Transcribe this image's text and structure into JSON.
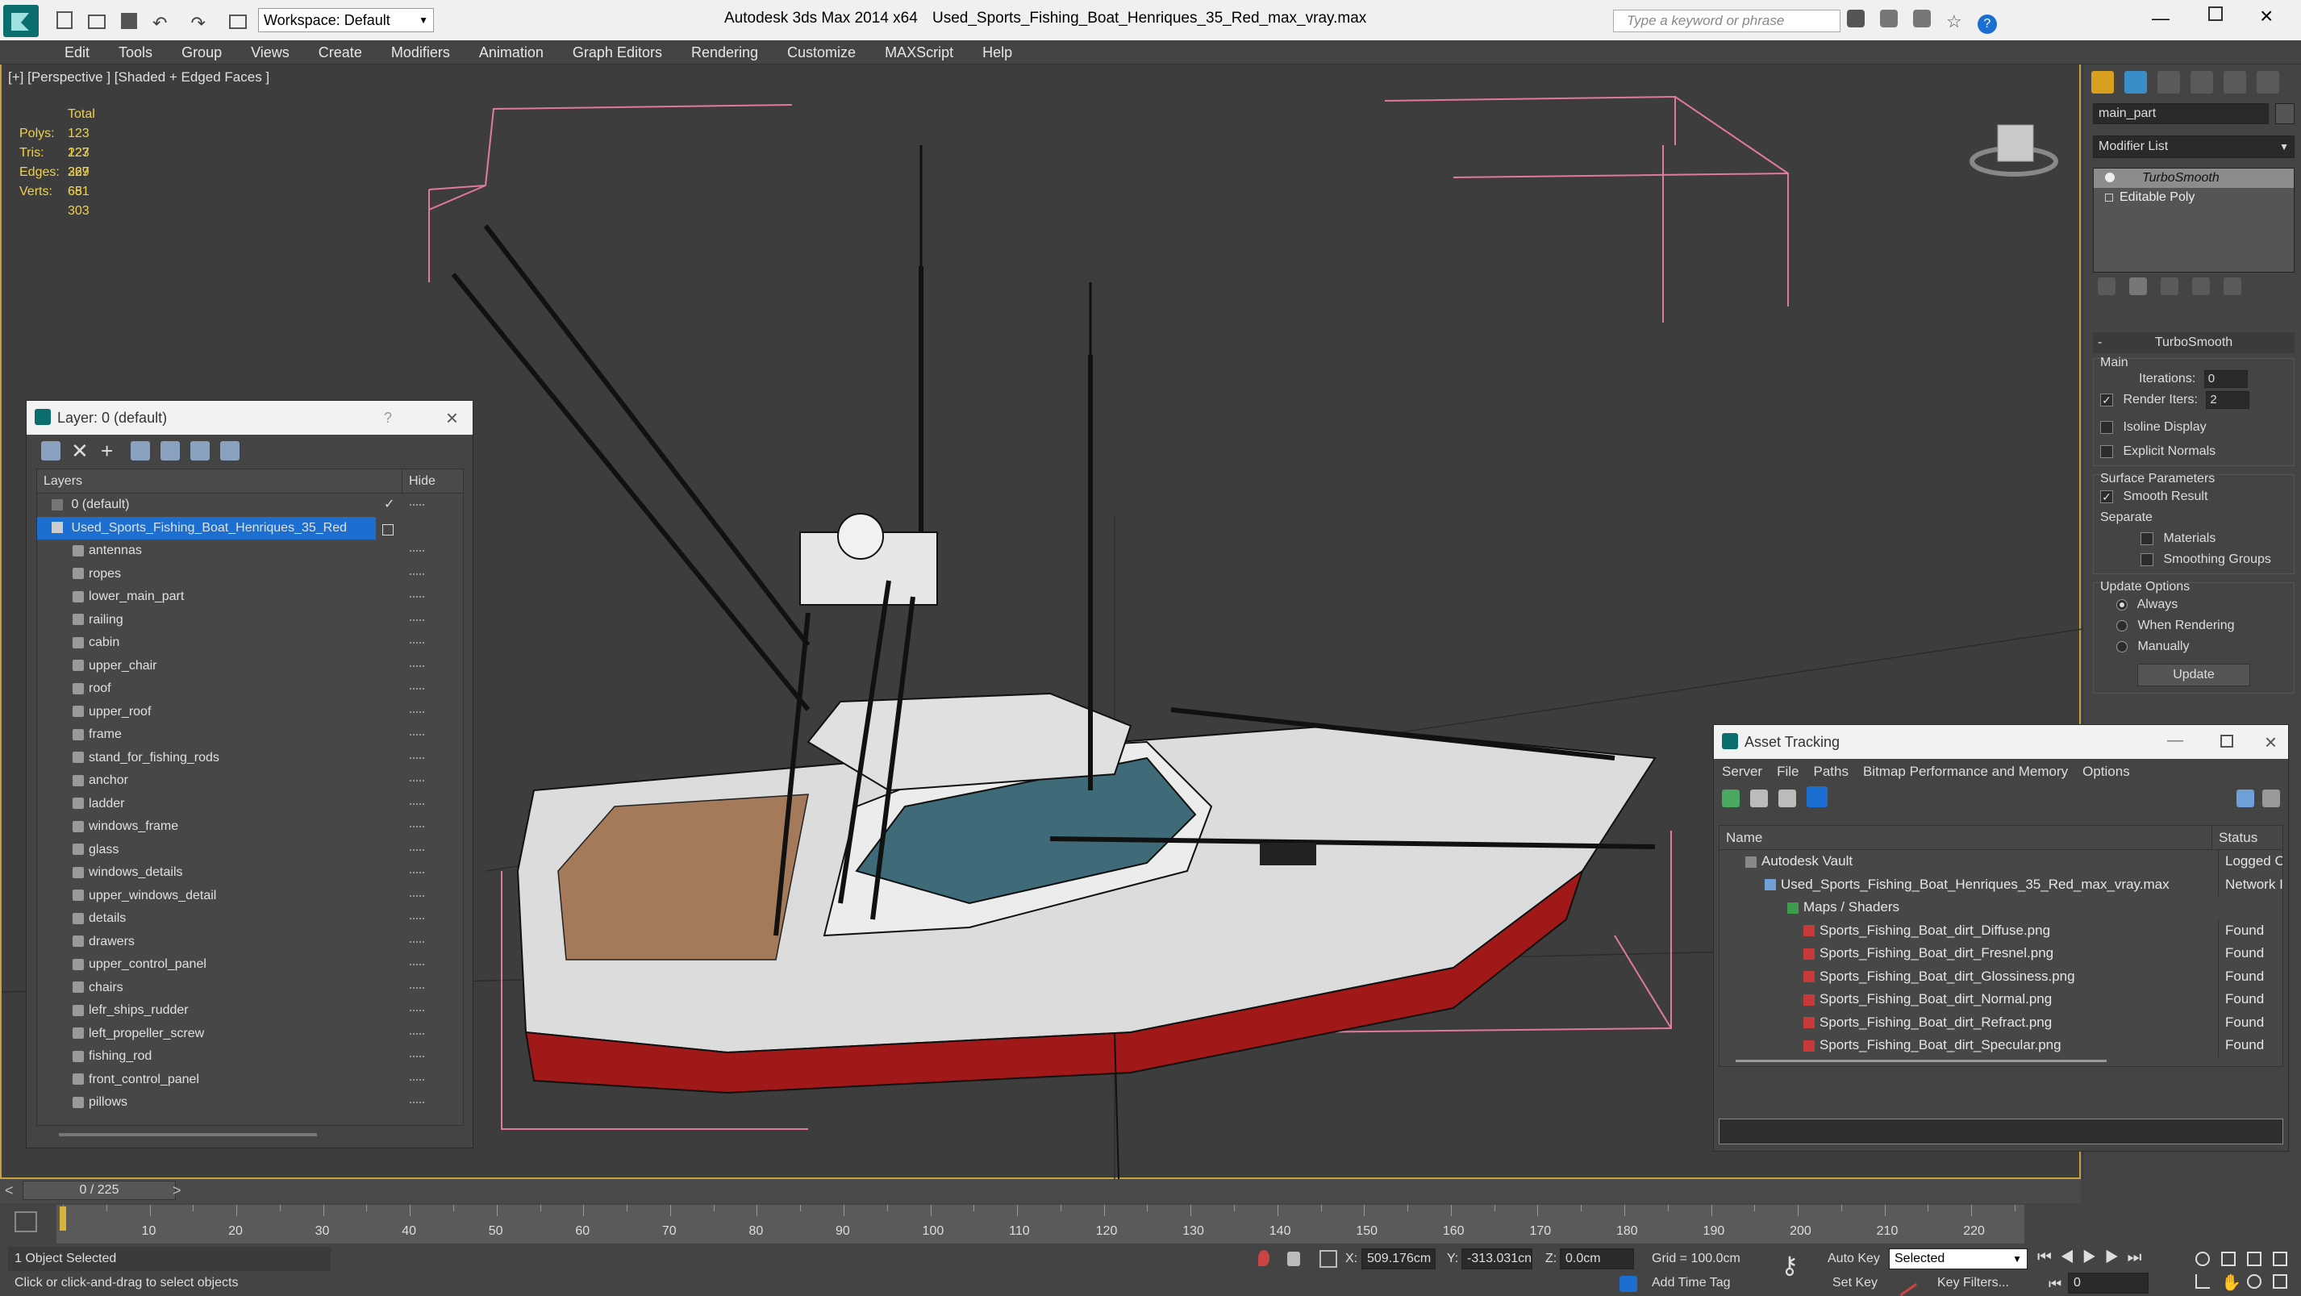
{
  "titlebar": {
    "workspace_label": "Workspace: Default",
    "app_title": "Autodesk 3ds Max  2014 x64",
    "file_title": "Used_Sports_Fishing_Boat_Henriques_35_Red_max_vray.max",
    "search_placeholder": "Type a keyword or phrase",
    "help_label": "?"
  },
  "menubar": {
    "items": [
      "Edit",
      "Tools",
      "Group",
      "Views",
      "Create",
      "Modifiers",
      "Animation",
      "Graph Editors",
      "Rendering",
      "Customize",
      "MAXScript",
      "Help"
    ]
  },
  "viewport": {
    "label": "[+] [Perspective ] [Shaded + Edged Faces ]",
    "stats": {
      "header": "Total",
      "rows": [
        {
          "label": "Polys:",
          "value": "123 227"
        },
        {
          "label": "Tris:",
          "value": "123 227"
        },
        {
          "label": "Edges:",
          "value": "369 681"
        },
        {
          "label": "Verts:",
          "value": "65 303"
        }
      ]
    }
  },
  "layer_window": {
    "title": "Layer: 0 (default)",
    "help": "?",
    "col_layers": "Layers",
    "col_hide": "Hide",
    "default_layer": "0 (default)",
    "selected_layer": "Used_Sports_Fishing_Boat_Henriques_35_Red",
    "children": [
      "antennas",
      "ropes",
      "lower_main_part",
      "railing",
      "cabin",
      "upper_chair",
      "roof",
      "upper_roof",
      "frame",
      "stand_for_fishing_rods",
      "anchor",
      "ladder",
      "windows_frame",
      "glass",
      "windows_details",
      "upper_windows_detail",
      "details",
      "drawers",
      "upper_control_panel",
      "chairs",
      "lefr_ships_rudder",
      "left_propeller_screw",
      "fishing_rod",
      "front_control_panel",
      "pillows"
    ]
  },
  "command_panel": {
    "object_name": "main_part",
    "modifier_list": "Modifier List",
    "stack": [
      "TurboSmooth",
      "Editable Poly"
    ],
    "rollout_title": "TurboSmooth",
    "main_group": "Main",
    "iterations_label": "Iterations:",
    "iterations_value": "0",
    "render_iters_label": "Render Iters:",
    "render_iters_value": "2",
    "isoline_label": "Isoline Display",
    "explicit_normals_label": "Explicit Normals",
    "surface_group": "Surface Parameters",
    "smooth_result_label": "Smooth Result",
    "separate_label": "Separate",
    "materials_label": "Materials",
    "smoothing_groups_label": "Smoothing Groups",
    "update_group": "Update Options",
    "always_label": "Always",
    "when_rendering_label": "When Rendering",
    "manually_label": "Manually",
    "update_button": "Update"
  },
  "asset_tracking": {
    "title": "Asset Tracking",
    "menu": [
      "Server",
      "File",
      "Paths",
      "Bitmap Performance and Memory",
      "Options"
    ],
    "col_name": "Name",
    "col_status": "Status",
    "rows": [
      {
        "name": "Autodesk Vault",
        "status": "Logged C"
      },
      {
        "name": "Used_Sports_Fishing_Boat_Henriques_35_Red_max_vray.max",
        "status": "Network I"
      },
      {
        "name": "Maps / Shaders",
        "status": ""
      },
      {
        "name": "Sports_Fishing_Boat_dirt_Diffuse.png",
        "status": "Found"
      },
      {
        "name": "Sports_Fishing_Boat_dirt_Fresnel.png",
        "status": "Found"
      },
      {
        "name": "Sports_Fishing_Boat_dirt_Glossiness.png",
        "status": "Found"
      },
      {
        "name": "Sports_Fishing_Boat_dirt_Normal.png",
        "status": "Found"
      },
      {
        "name": "Sports_Fishing_Boat_dirt_Refract.png",
        "status": "Found"
      },
      {
        "name": "Sports_Fishing_Boat_dirt_Specular.png",
        "status": "Found"
      }
    ]
  },
  "timeline": {
    "frame_counter": "0 / 225",
    "ticks": [
      "10",
      "20",
      "30",
      "40",
      "50",
      "60",
      "70",
      "80",
      "90",
      "100",
      "110",
      "120",
      "130",
      "140",
      "150",
      "160",
      "170",
      "180",
      "190",
      "200",
      "210",
      "220"
    ]
  },
  "statusbar": {
    "selection": "1 Object Selected",
    "prompt": "Click or click-and-drag to select objects",
    "x_label": "X:",
    "x_value": "509.176cm",
    "y_label": "Y:",
    "y_value": "-313.031cn",
    "z_label": "Z:",
    "z_value": "0.0cm",
    "grid": "Grid = 100.0cm",
    "auto_key": "Auto Key",
    "selected": "Selected",
    "set_key": "Set Key",
    "key_filters": "Key Filters...",
    "add_time_tag": "Add Time Tag",
    "frame_value": "0"
  },
  "colors": {
    "accent": "#1c6fd1",
    "viewport_border": "#c7a13b",
    "stats_yellow": "#f0d24a",
    "bbox_pink": "#e27a9a"
  }
}
